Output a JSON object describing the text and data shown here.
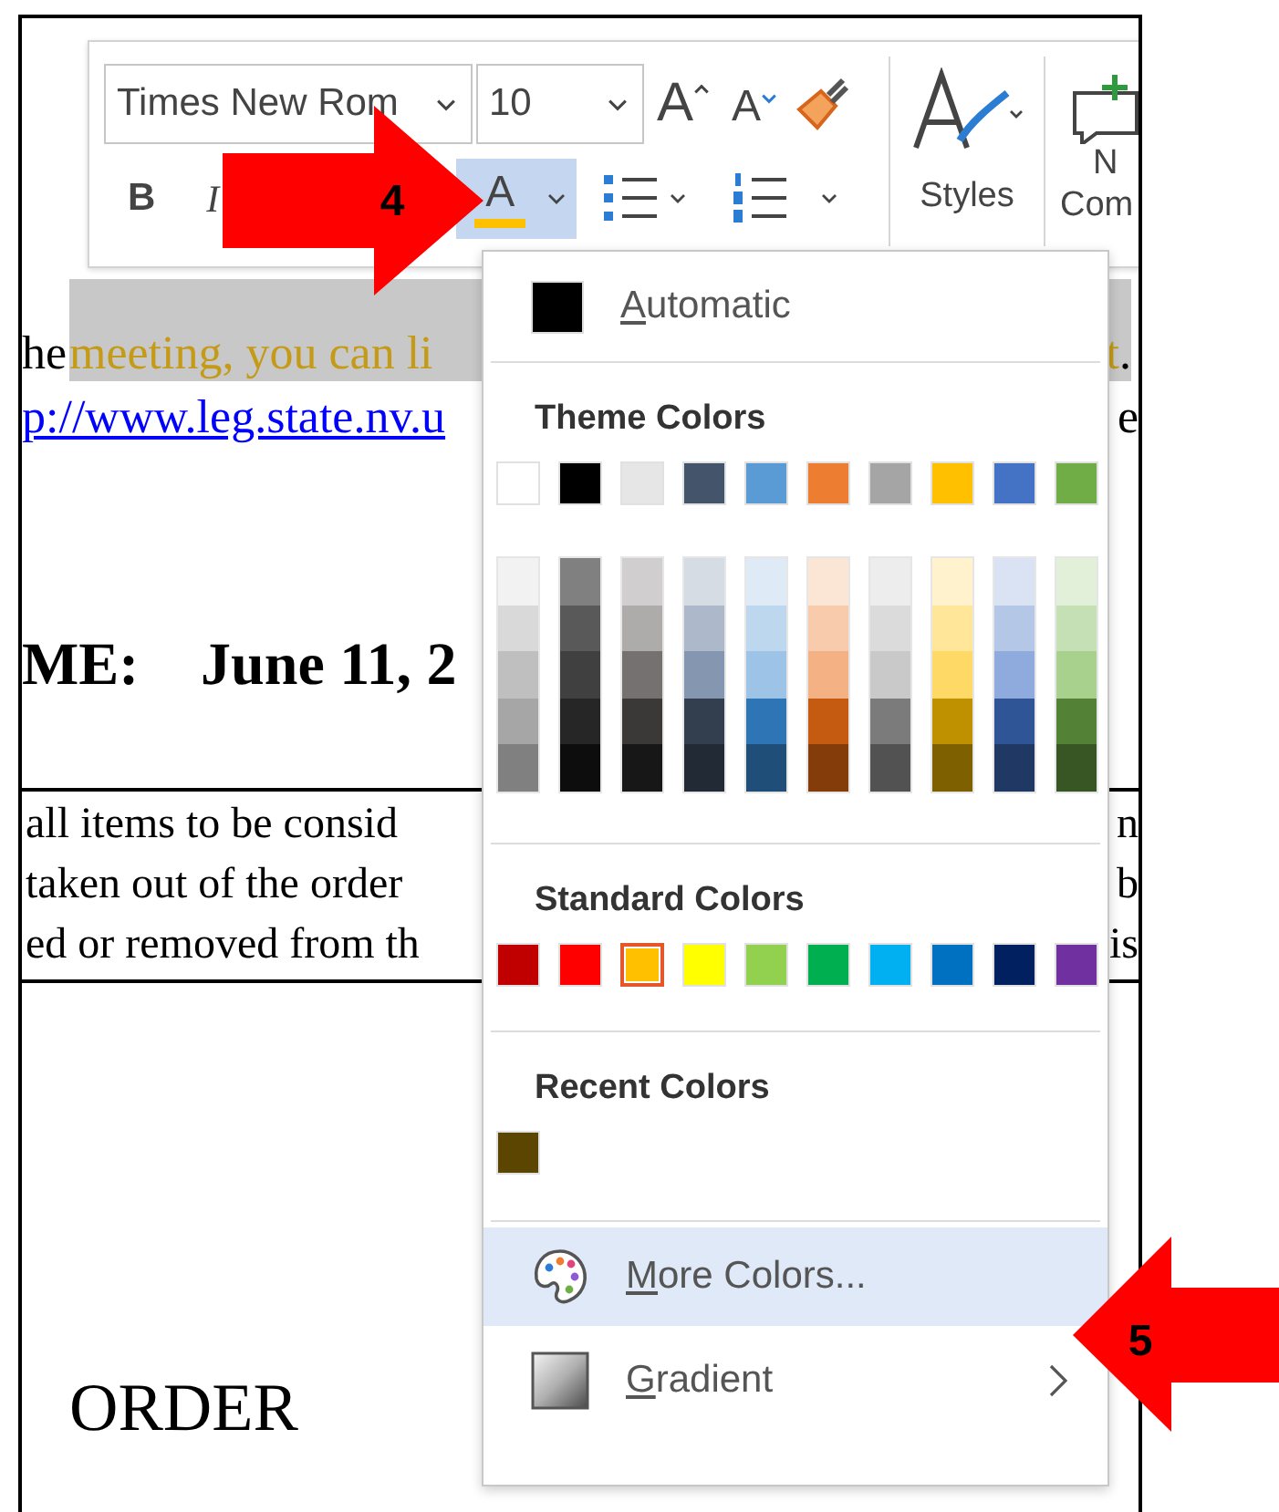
{
  "ribbon": {
    "font_name": "Times New Rom",
    "font_size": "10",
    "grow_font": "A",
    "shrink_font": "A",
    "bold": "B",
    "italic": "I",
    "font_color": {
      "letter": "A",
      "color": "#ffc000",
      "selected": true
    },
    "styles_label": "Styles",
    "cut_button_lines": [
      "N",
      "Com"
    ]
  },
  "document": {
    "highlight_line": {
      "lead": "he",
      "highlighted": "meeting, you can li",
      "tail": "t",
      "tail_end": "."
    },
    "link_line": {
      "link": "p://www.leg.state.nv.u",
      "tail": "e"
    },
    "date_line": {
      "label": "ME:",
      "value": "June 11, 2"
    },
    "boxed_lines": [
      {
        "left": "all items to be consid",
        "right": "n"
      },
      {
        "left": "taken out of the order",
        "right": "b"
      },
      {
        "left": "ed or removed from th",
        "right": "is"
      }
    ],
    "heading": "ORDER"
  },
  "color_menu": {
    "automatic": {
      "label": "Automatic",
      "color": "#000000"
    },
    "theme_heading": "Theme Colors",
    "theme_colors": [
      {
        "color": "#ffffff",
        "selected": false,
        "shades": [
          {
            "color": "#f2f2f2"
          },
          {
            "color": "#d9d9d9"
          },
          {
            "color": "#bfbfbf"
          },
          {
            "color": "#a6a6a6"
          },
          {
            "color": "#808080"
          }
        ]
      },
      {
        "color": "#000000",
        "selected": false,
        "shades": [
          {
            "color": "#808080"
          },
          {
            "color": "#595959"
          },
          {
            "color": "#404040"
          },
          {
            "color": "#262626"
          },
          {
            "color": "#0d0d0d"
          }
        ]
      },
      {
        "color": "#e7e6e6",
        "selected": false,
        "shades": [
          {
            "color": "#d0cece"
          },
          {
            "color": "#aeabab"
          },
          {
            "color": "#767171"
          },
          {
            "color": "#3b3838"
          },
          {
            "color": "#181717"
          }
        ]
      },
      {
        "color": "#44546a",
        "selected": false,
        "shades": [
          {
            "color": "#d6dce4"
          },
          {
            "color": "#adb9ca"
          },
          {
            "color": "#8496b0"
          },
          {
            "color": "#333f4f"
          },
          {
            "color": "#222a35"
          }
        ]
      },
      {
        "color": "#5b9bd5",
        "selected": false,
        "shades": [
          {
            "color": "#deebf6"
          },
          {
            "color": "#bdd7ee"
          },
          {
            "color": "#9dc3e6"
          },
          {
            "color": "#2e75b5"
          },
          {
            "color": "#1f4e79"
          }
        ]
      },
      {
        "color": "#ed7d31",
        "selected": false,
        "shades": [
          {
            "color": "#fbe5d5"
          },
          {
            "color": "#f7cbac"
          },
          {
            "color": "#f4b183"
          },
          {
            "color": "#c55a11"
          },
          {
            "color": "#843c0b"
          }
        ]
      },
      {
        "color": "#a5a5a5",
        "selected": false,
        "shades": [
          {
            "color": "#ededed"
          },
          {
            "color": "#dbdbdb"
          },
          {
            "color": "#c9c9c9"
          },
          {
            "color": "#7b7b7b"
          },
          {
            "color": "#525252"
          }
        ]
      },
      {
        "color": "#ffc000",
        "selected": false,
        "shades": [
          {
            "color": "#fff2cc"
          },
          {
            "color": "#ffe699"
          },
          {
            "color": "#ffd966"
          },
          {
            "color": "#bf9000"
          },
          {
            "color": "#7f6000"
          }
        ]
      },
      {
        "color": "#4472c4",
        "selected": false,
        "shades": [
          {
            "color": "#dae3f3"
          },
          {
            "color": "#b4c7e7"
          },
          {
            "color": "#8faadc"
          },
          {
            "color": "#2f5597"
          },
          {
            "color": "#203864"
          }
        ]
      },
      {
        "color": "#70ad47",
        "selected": false,
        "shades": [
          {
            "color": "#e2f0d9"
          },
          {
            "color": "#c5e0b4"
          },
          {
            "color": "#a9d18e"
          },
          {
            "color": "#538135"
          },
          {
            "color": "#375623"
          }
        ]
      }
    ],
    "standard_heading": "Standard Colors",
    "standard_colors": [
      {
        "color": "#c00000",
        "selected": false
      },
      {
        "color": "#ff0000",
        "selected": false
      },
      {
        "color": "#ffc000",
        "selected": true
      },
      {
        "color": "#ffff00",
        "selected": false
      },
      {
        "color": "#92d050",
        "selected": false
      },
      {
        "color": "#00b050",
        "selected": false
      },
      {
        "color": "#00b0f0",
        "selected": false
      },
      {
        "color": "#0070c0",
        "selected": false
      },
      {
        "color": "#002060",
        "selected": false
      },
      {
        "color": "#7030a0",
        "selected": false
      }
    ],
    "recent_heading": "Recent Colors",
    "recent_colors": [
      {
        "color": "#5c4500",
        "selected": false
      }
    ],
    "actions": [
      {
        "kind": "more",
        "label": "More Colors...",
        "hovered": true
      },
      {
        "kind": "gradient",
        "label": "Gradient",
        "hovered": false
      }
    ]
  },
  "callouts": [
    {
      "number": "4",
      "kind": "right"
    },
    {
      "number": "5",
      "kind": "left"
    }
  ]
}
